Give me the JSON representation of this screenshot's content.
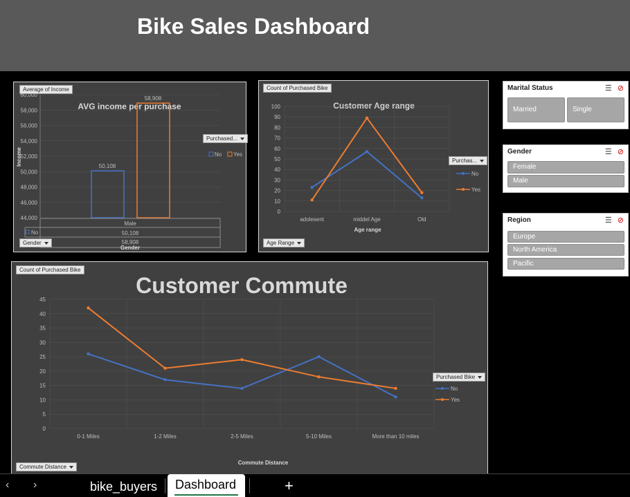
{
  "title": "Bike Sales Dashboard",
  "income_chart": {
    "field_top": "Average of Income",
    "title": "AVG income per purchase",
    "ylabel": "Income",
    "yticks": [
      "44,000",
      "46,000",
      "48,000",
      "50,000",
      "52,000",
      "54,000",
      "56,000",
      "58,000",
      "60,000"
    ],
    "legend_button": "Purchased...",
    "legend": [
      "No",
      "Yes"
    ],
    "table_header": "Male",
    "table_no_label": "No",
    "table_no_value": "50,108",
    "table_yes_value": "58,908",
    "xlabel": "Gender",
    "field_bottom": "Gender"
  },
  "age_chart": {
    "field_top": "Count of Purchased Bike",
    "title": "Customer Age range",
    "xlabel": "Age range",
    "legend_button": "Purchas...",
    "legend": [
      "No",
      "Yes"
    ],
    "field_bottom": "Age Range",
    "yticks": [
      "0",
      "10",
      "20",
      "30",
      "40",
      "50",
      "60",
      "70",
      "80",
      "90",
      "100"
    ]
  },
  "commute_chart": {
    "field_top": "Count of Purchased Bike",
    "title": "Customer Commute",
    "xlabel": "Commute Distance",
    "legend_button": "Purchased Bike",
    "legend": [
      "No",
      "Yes"
    ],
    "field_bottom": "Commute Distance",
    "yticks": [
      "0",
      "5",
      "10",
      "15",
      "20",
      "25",
      "30",
      "35",
      "40",
      "45"
    ]
  },
  "chart_data": [
    {
      "type": "bar",
      "title": "AVG income per purchase",
      "categories": [
        "Male"
      ],
      "series": [
        {
          "name": "No",
          "values": [
            50108
          ]
        },
        {
          "name": "Yes",
          "values": [
            58908
          ]
        }
      ],
      "ylabel": "Income",
      "xlabel": "Gender",
      "ylim": [
        44000,
        60000
      ],
      "data_labels": [
        "50,108",
        "58,908"
      ],
      "colors": {
        "No": "#4472c4",
        "Yes": "#ed7d31"
      }
    },
    {
      "type": "line",
      "title": "Customer Age range",
      "categories": [
        "adolesent",
        "middel Age",
        "Old"
      ],
      "series": [
        {
          "name": "No",
          "values": [
            23,
            57,
            13
          ]
        },
        {
          "name": "Yes",
          "values": [
            11,
            89,
            18
          ]
        }
      ],
      "xlabel": "Age range",
      "ylim": [
        0,
        100
      ],
      "colors": {
        "No": "#4472c4",
        "Yes": "#ed7d31"
      }
    },
    {
      "type": "line",
      "title": "Customer Commute",
      "categories": [
        "0-1 Miles",
        "1-2 Miles",
        "2-5 Miles",
        "5-10 Miles",
        "More than 10 miles"
      ],
      "series": [
        {
          "name": "No",
          "values": [
            26,
            17,
            14,
            25,
            11
          ]
        },
        {
          "name": "Yes",
          "values": [
            42,
            21,
            24,
            18,
            14
          ]
        }
      ],
      "xlabel": "Commute Distance",
      "ylim": [
        0,
        45
      ],
      "colors": {
        "No": "#4472c4",
        "Yes": "#ed7d31"
      }
    }
  ],
  "slicers": {
    "marital": {
      "title": "Marital Status",
      "items": [
        "Married",
        "Single"
      ]
    },
    "gender": {
      "title": "Gender",
      "items": [
        "Female",
        "Male"
      ]
    },
    "region": {
      "title": "Region",
      "items": [
        "Europe",
        "North America",
        "Pacific"
      ]
    }
  },
  "tabs": {
    "sheet1": "bike_buyers",
    "sheet2": "Dashboard",
    "add": "+"
  }
}
